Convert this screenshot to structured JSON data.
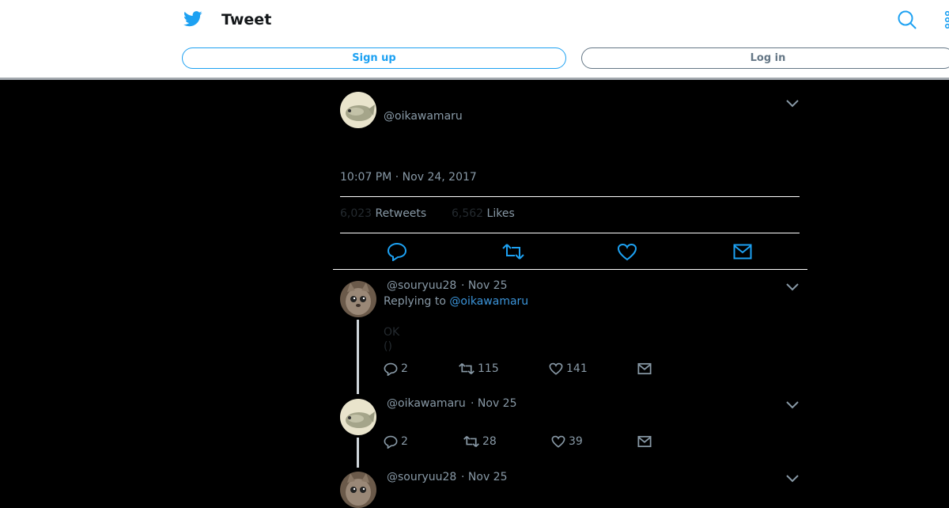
{
  "header": {
    "title": "Tweet",
    "signup_label": "Sign up",
    "login_label": "Log in",
    "icons": [
      "twitter-bird-icon",
      "search-icon",
      "more-icon"
    ]
  },
  "main_tweet": {
    "handle": "@oikawamaru",
    "timestamp": "10:07 PM · Nov 24, 2017",
    "retweets_count": "6,023",
    "retweets_label": "Retweets",
    "likes_count": "6,562",
    "likes_label": "Likes"
  },
  "replies": [
    {
      "handle": "@souryuu28",
      "date": "· Nov 25",
      "replying_prefix": "Replying to ",
      "replying_handle": "@oikawamaru",
      "text_line1": "OK",
      "text_line2": "()",
      "reply_count": "2",
      "retweet_count": "115",
      "like_count": "141"
    },
    {
      "handle": "@oikawamaru",
      "date": "· Nov 25",
      "reply_count": "2",
      "retweet_count": "28",
      "like_count": "39"
    },
    {
      "handle": "@souryuu28",
      "date": "· Nov 25"
    }
  ],
  "colors": {
    "accent": "#1da1f2",
    "background": "#000000",
    "muted": "#8899a6"
  }
}
